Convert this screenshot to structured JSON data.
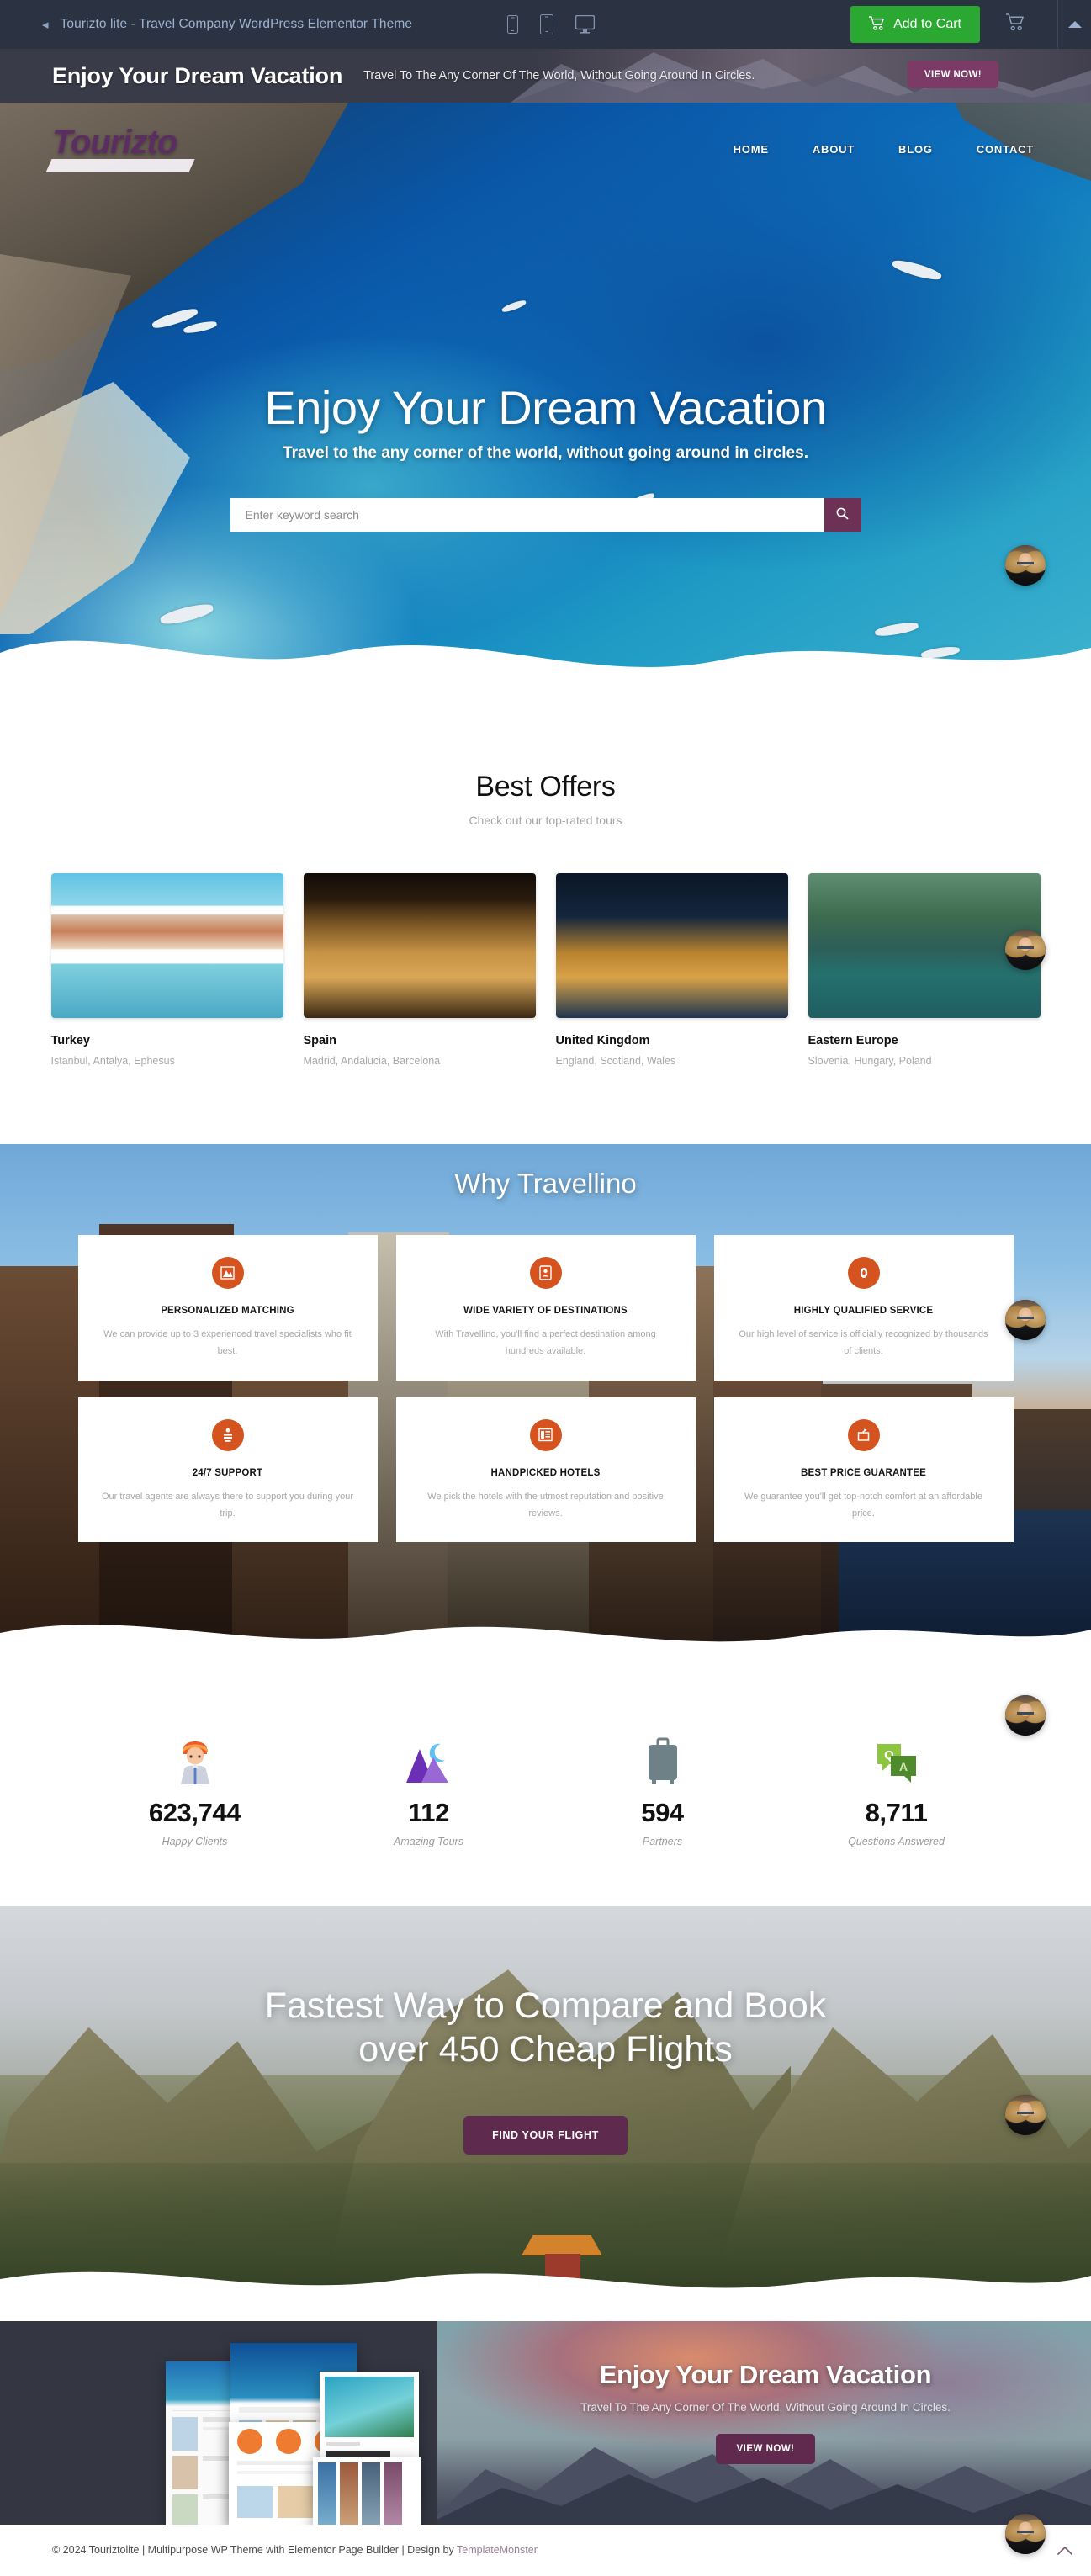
{
  "topbar": {
    "back_icon": "chevron-left-icon",
    "title": "Tourizto lite - Travel Company WordPress Elementor Theme",
    "devices": [
      "mobile-portrait-icon",
      "tablet-icon",
      "desktop-icon"
    ],
    "add_to_cart_label": "Add to Cart",
    "cart_icon": "shopping-cart-icon",
    "basket_icon": "shopping-basket-icon",
    "collapse_icon": "triangle-up-icon"
  },
  "promo_strip": {
    "heading": "Enjoy Your Dream Vacation",
    "subheading": "Travel To The Any Corner Of The World, Without Going Around In Circles.",
    "button_label": "VIEW NOW!"
  },
  "site_header": {
    "logo_text": "Tourizto",
    "nav": [
      {
        "label": "HOME"
      },
      {
        "label": "ABOUT"
      },
      {
        "label": "BLOG"
      },
      {
        "label": "CONTACT"
      }
    ]
  },
  "hero": {
    "title": "Enjoy Your Dream Vacation",
    "subtitle": "Travel to the any corner of the world, without going around in circles.",
    "search_placeholder": "Enter keyword search",
    "search_value": "",
    "search_icon": "search-icon"
  },
  "best_offers": {
    "title": "Best Offers",
    "subtitle": "Check out our top-rated tours",
    "cards": [
      {
        "name": "Turkey",
        "places": "Istanbul, Antalya, Ephesus",
        "image": "turkey-coastal-town-photo"
      },
      {
        "name": "Spain",
        "places": "Madrid, Andalucia, Barcelona",
        "image": "spain-night-building-photo"
      },
      {
        "name": "United Kingdom",
        "places": "England, Scotland, Wales",
        "image": "tower-bridge-photo"
      },
      {
        "name": "Eastern Europe",
        "places": "Slovenia, Hungary, Poland",
        "image": "bled-island-photo"
      }
    ]
  },
  "why": {
    "title": "Why Travellino",
    "features": [
      {
        "icon": "mountain-icon",
        "name": "PERSONALIZED MATCHING",
        "text": "We can provide up to 3 experienced travel specialists who fit best."
      },
      {
        "icon": "id-card-icon",
        "name": "WIDE VARIETY OF DESTINATIONS",
        "text": "With Travellino, you'll find a perfect destination among hundreds available."
      },
      {
        "icon": "medal-icon",
        "name": "HIGHLY QUALIFIED SERVICE",
        "text": "Our high level of service is officially recognized by thousands of clients."
      },
      {
        "icon": "support-icon",
        "name": "24/7 SUPPORT",
        "text": "Our travel agents are always there to support you during your trip."
      },
      {
        "icon": "hotel-icon",
        "name": "HANDPICKED HOTELS",
        "text": "We pick the hotels with the utmost reputation and positive reviews."
      },
      {
        "icon": "price-tag-icon",
        "name": "BEST PRICE GUARANTEE",
        "text": "We guarantee you'll get top-notch comfort at an affordable price."
      }
    ]
  },
  "counters": [
    {
      "icon": "person-icon",
      "value": "623,744",
      "label": "Happy Clients"
    },
    {
      "icon": "mountains-moon-icon",
      "value": "112",
      "label": "Amazing Tours"
    },
    {
      "icon": "suitcase-icon",
      "value": "594",
      "label": "Partners"
    },
    {
      "icon": "qa-chat-icon",
      "value": "8,711",
      "label": "Questions Answered"
    }
  ],
  "flights": {
    "heading_line1": "Fastest Way to Compare and Book",
    "heading_line2": "over 450 Cheap Flights",
    "button_label": "FIND YOUR FLIGHT"
  },
  "bottom_promo": {
    "heading": "Enjoy Your Dream Vacation",
    "subheading": "Travel To The Any Corner Of The World, Without Going Around In Circles.",
    "button_label": "VIEW NOW!"
  },
  "footer": {
    "copyright": "© 2024 Touriztolite | Multipurpose WP Theme with Elementor Page Builder | Design by ",
    "designer": "TemplateMonster",
    "to_top_icon": "chevron-up-icon"
  },
  "widget": {
    "avatar_icon": "video-chat-avatar"
  },
  "colors": {
    "topbar_bg": "#2b3343",
    "cart_green": "#2aa832",
    "accent_purple": "#5f2a4e",
    "why_icon_orange": "#d4531e",
    "logo_purple": "#5c2d63",
    "link_mauve": "#9a7f96"
  }
}
